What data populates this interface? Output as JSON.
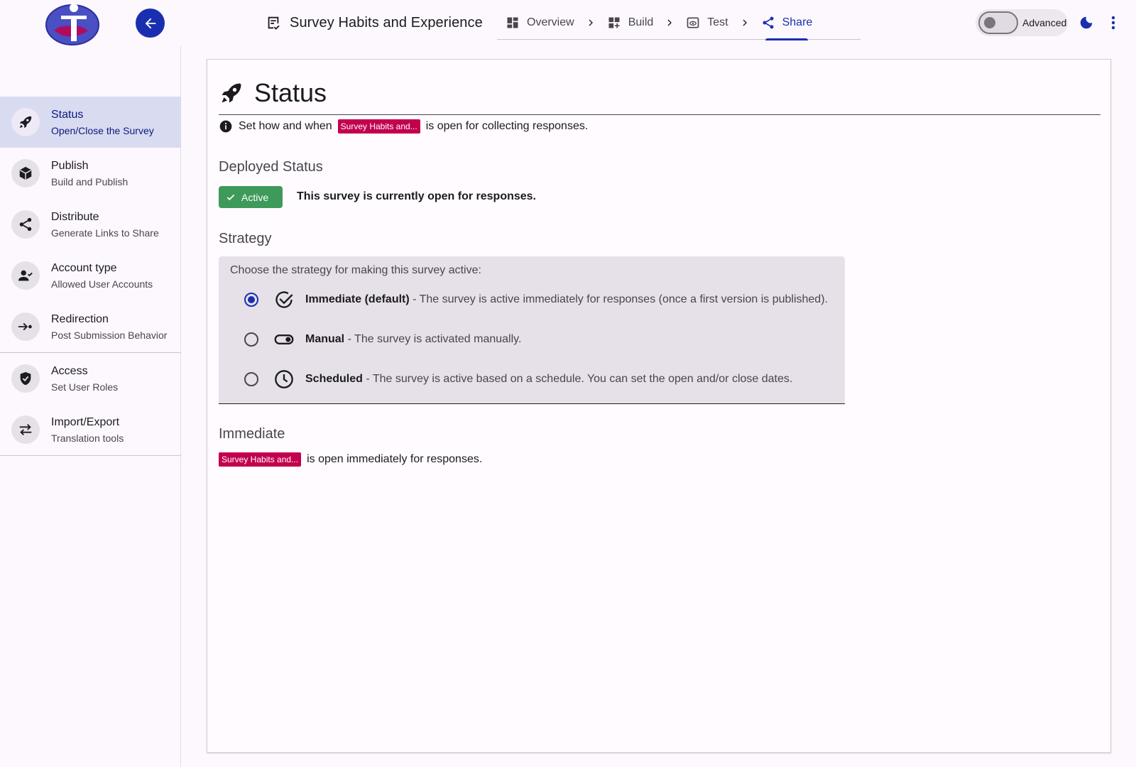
{
  "header": {
    "survey_title": "Survey Habits and Experience",
    "steps": [
      {
        "label": "Overview",
        "icon": "dashboard-icon"
      },
      {
        "label": "Build",
        "icon": "dashboard-add-icon"
      },
      {
        "label": "Test",
        "icon": "preview-icon"
      },
      {
        "label": "Share",
        "icon": "share-icon",
        "active": true
      }
    ],
    "advanced_label": "Advanced",
    "advanced_on": false
  },
  "sidebar": {
    "items": [
      {
        "title": "Status",
        "subtitle": "Open/Close the Survey",
        "icon": "rocket-icon",
        "active": true
      },
      {
        "title": "Publish",
        "subtitle": "Build and Publish",
        "icon": "cube-icon"
      },
      {
        "title": "Distribute",
        "subtitle": "Generate Links to Share",
        "icon": "share-icon"
      },
      {
        "title": "Account type",
        "subtitle": "Allowed User Accounts",
        "icon": "person-check-icon"
      },
      {
        "title": "Redirection",
        "subtitle": "Post Submission Behavior",
        "icon": "redirect-icon"
      },
      {
        "title": "Access",
        "subtitle": "Set User Roles",
        "icon": "shield-icon"
      },
      {
        "title": "Import/Export",
        "subtitle": "Translation tools",
        "icon": "swap-icon"
      }
    ]
  },
  "main": {
    "title": "Status",
    "info_prefix": "Set how and when",
    "survey_chip": "Survey Habits and...",
    "info_suffix": "is open for collecting responses.",
    "deployed_title": "Deployed Status",
    "badge_label": "Active",
    "deployed_message": "This survey is currently open for responses.",
    "strategy_title": "Strategy",
    "strategy_prompt": "Choose the strategy for making this survey active:",
    "options": [
      {
        "name": "Immediate (default)",
        "desc": " - The survey is active immediately for responses (once a first version is published).",
        "selected": true,
        "icon": "check-circle-icon"
      },
      {
        "name": "Manual",
        "desc": " - The survey is activated manually.",
        "selected": false,
        "icon": "toggle-icon"
      },
      {
        "name": "Scheduled",
        "desc": " - The survey is active based on a schedule. You can set the open and/or close dates.",
        "selected": false,
        "icon": "clock-icon"
      }
    ],
    "immediate_title": "Immediate",
    "immediate_chip": "Survey Habits and...",
    "immediate_text": "is open immediately for responses."
  },
  "colors": {
    "primary": "#1a2fb0",
    "chip": "#c2004e",
    "active_badge": "#3e9a5b",
    "sidebar_active": "#d9dbf1"
  }
}
